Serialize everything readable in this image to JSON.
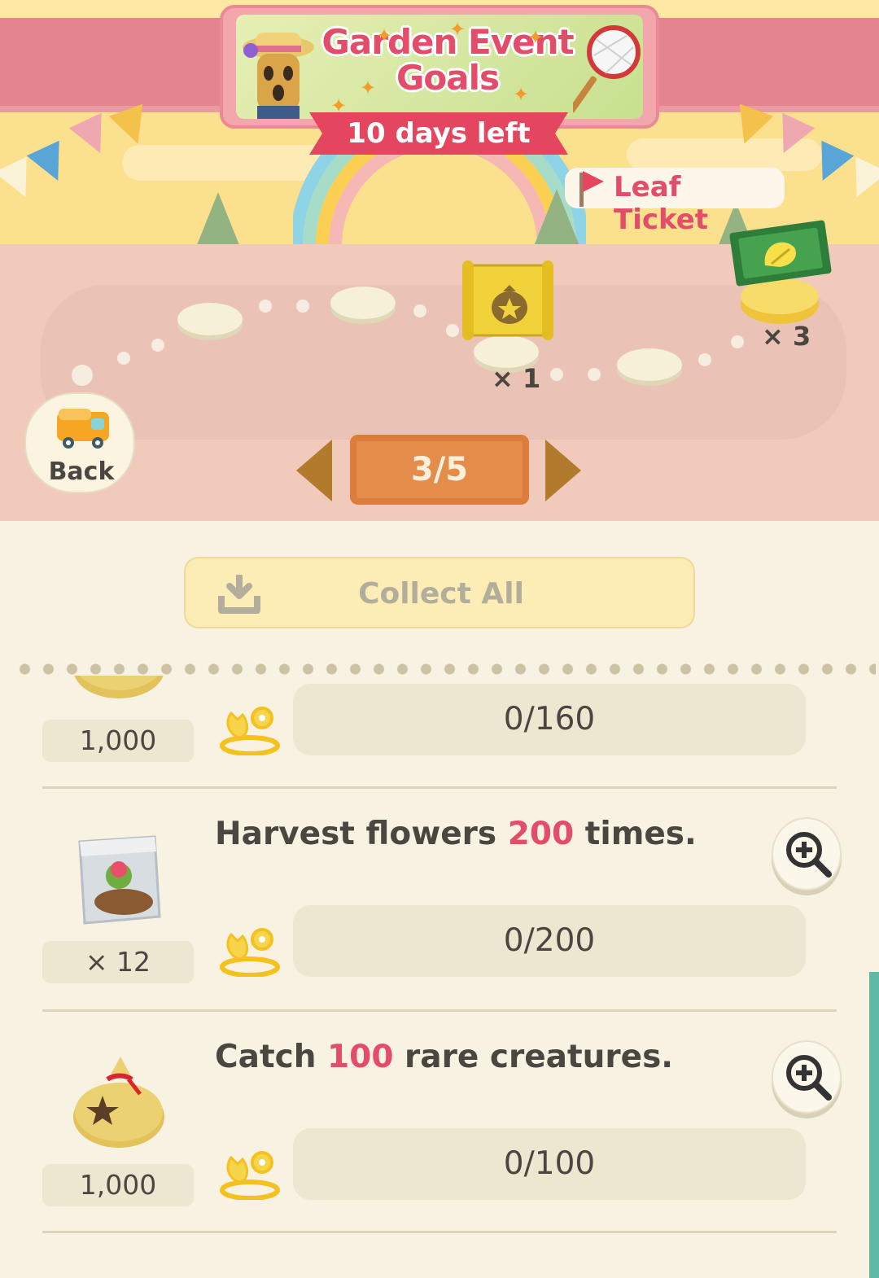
{
  "header": {
    "title_line1": "Garden Event",
    "title_line2": "Goals",
    "days_left": "10 days left"
  },
  "track": {
    "next_reward_label": "Leaf Ticket",
    "reward_counts": [
      "× 1",
      "× 3"
    ]
  },
  "nav": {
    "back_label": "Back",
    "page": "3/5"
  },
  "panel": {
    "collect_all_label": "Collect All"
  },
  "tasks": [
    {
      "title_before": "",
      "title_highlight": "",
      "title_after": "",
      "reward": "1,000",
      "reward_icon": "bell-bag-icon",
      "progress": "0/160",
      "progress_fraction": 0
    },
    {
      "title_before": "Harvest flowers ",
      "title_highlight": "200",
      "title_after": " times.",
      "reward": "× 12",
      "reward_icon": "seed-bag-icon",
      "progress": "0/200",
      "progress_fraction": 0
    },
    {
      "title_before": "Catch ",
      "title_highlight": "100",
      "title_after": " rare creatures.",
      "reward": "1,000",
      "reward_icon": "bell-bag-icon",
      "progress": "0/100",
      "progress_fraction": 0
    }
  ],
  "colors": {
    "accent_pink": "#e34d69",
    "ribbon": "#e5465f",
    "pager": "#e48c4a",
    "panel_bg": "#f7f2e2"
  }
}
